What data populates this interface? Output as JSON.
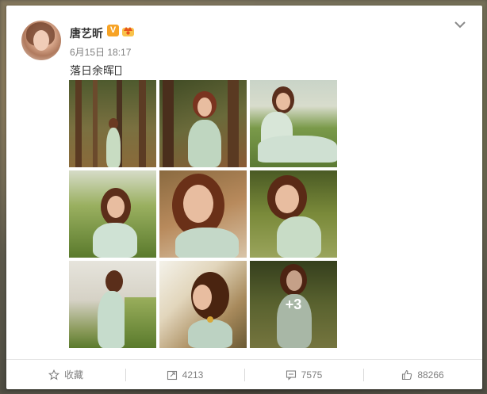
{
  "post": {
    "username": "唐艺昕",
    "verified_badge": "V",
    "time": "6月15日 18:17",
    "text": "落日余晖",
    "more_photos_label": "+3"
  },
  "photos": [
    {
      "name": "photo-1",
      "scene": "forest-trees-standing"
    },
    {
      "name": "photo-2",
      "scene": "forest-portrait-closeup"
    },
    {
      "name": "photo-3",
      "scene": "seated-in-grass-by-lake"
    },
    {
      "name": "photo-4",
      "scene": "portrait-in-grass"
    },
    {
      "name": "photo-5",
      "scene": "hand-in-hair-closeup"
    },
    {
      "name": "photo-6",
      "scene": "eyes-closed-in-field"
    },
    {
      "name": "photo-7",
      "scene": "back-view-by-water"
    },
    {
      "name": "photo-8",
      "scene": "sunlight-profile"
    },
    {
      "name": "photo-9",
      "scene": "standing-in-field-more"
    }
  ],
  "actions": {
    "favorite": {
      "label": "收藏",
      "icon": "star-icon"
    },
    "repost": {
      "label": "4213",
      "icon": "repost-icon"
    },
    "comment": {
      "label": "7575",
      "icon": "comment-icon"
    },
    "like": {
      "label": "88266",
      "icon": "thumbs-up-icon"
    }
  },
  "colors": {
    "accent_badge": "#f7a325",
    "text_main": "#333333",
    "text_muted": "#808080"
  }
}
